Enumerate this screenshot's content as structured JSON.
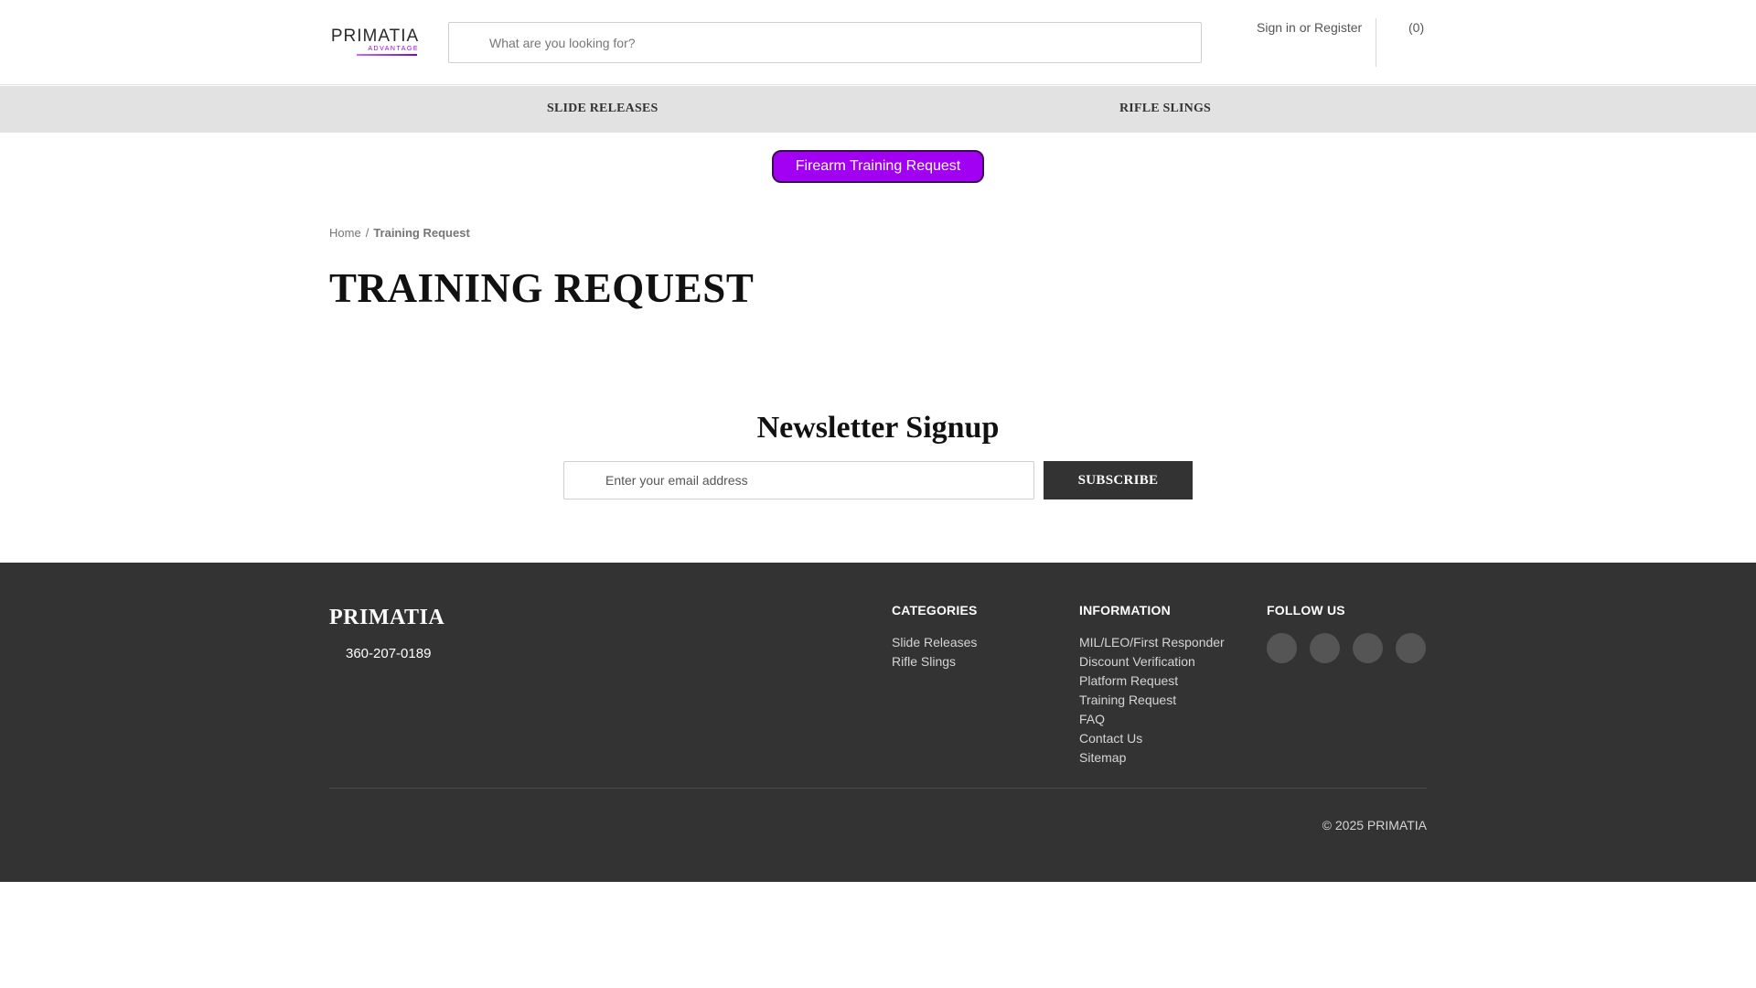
{
  "header": {
    "logo_word": "PRIMATIA",
    "logo_sub": "ADVANTAGE",
    "search_placeholder": "What are you looking for?",
    "sign_in": "Sign in",
    "or": "or",
    "register": "Register",
    "cart_count": "(0)"
  },
  "nav": {
    "items": [
      {
        "label": "SLIDE RELEASES"
      },
      {
        "label": "RIFLE SLINGS"
      }
    ]
  },
  "promo": {
    "label": "Firearm Training Request",
    "color": "#a100f2"
  },
  "breadcrumb": {
    "home": "Home",
    "sep": "/",
    "current": "Training Request"
  },
  "page": {
    "title": "TRAINING REQUEST"
  },
  "newsletter": {
    "title": "Newsletter Signup",
    "placeholder": "Enter your email address",
    "button": "SUBSCRIBE"
  },
  "footer": {
    "brand": "PRIMATIA",
    "phone": "360-207-0189",
    "categories": {
      "heading": "CATEGORIES",
      "links": [
        "Slide Releases",
        "Rifle Slings"
      ]
    },
    "information": {
      "heading": "INFORMATION",
      "links": [
        "MIL/LEO/First Responder",
        "Discount Verification",
        "Platform Request",
        "Training Request",
        "FAQ",
        "Contact Us",
        "Sitemap"
      ]
    },
    "follow": {
      "heading": "FOLLOW US",
      "icons": [
        "social-icon-1",
        "social-icon-2",
        "social-icon-3",
        "social-icon-4"
      ]
    },
    "copyright": "© 2025 PRIMATIA"
  }
}
